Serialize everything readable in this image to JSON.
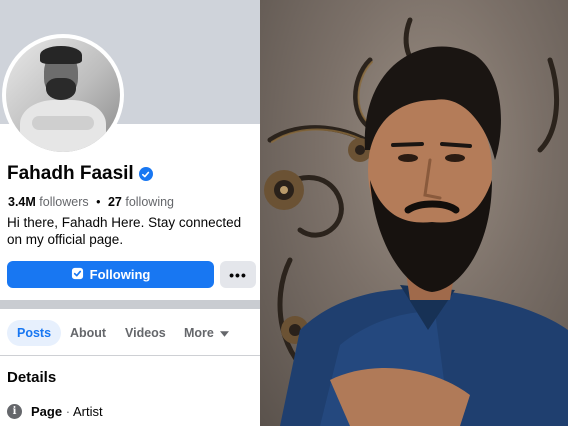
{
  "profile": {
    "name": "Fahadh Faasil",
    "verified_icon": "verified-badge-icon",
    "followers_count": "3.4M",
    "followers_label": "followers",
    "separator": "•",
    "following_count": "27",
    "following_label": "following",
    "bio": "Hi there, Fahadh Here. Stay connected on my official page.",
    "follow_button_label": "Following",
    "more_button_label": "•••"
  },
  "tabs": [
    {
      "label": "Posts",
      "active": true
    },
    {
      "label": "About",
      "active": false
    },
    {
      "label": "Videos",
      "active": false
    },
    {
      "label": "More",
      "active": false
    }
  ],
  "details": {
    "title": "Details",
    "info_icon_glyph": "i",
    "page_label": "Page",
    "page_dot": "·",
    "page_category": "Artist"
  },
  "colors": {
    "accent": "#1877f2",
    "cover": "#cfd3da",
    "text": "#050505",
    "muted": "#65676b"
  }
}
